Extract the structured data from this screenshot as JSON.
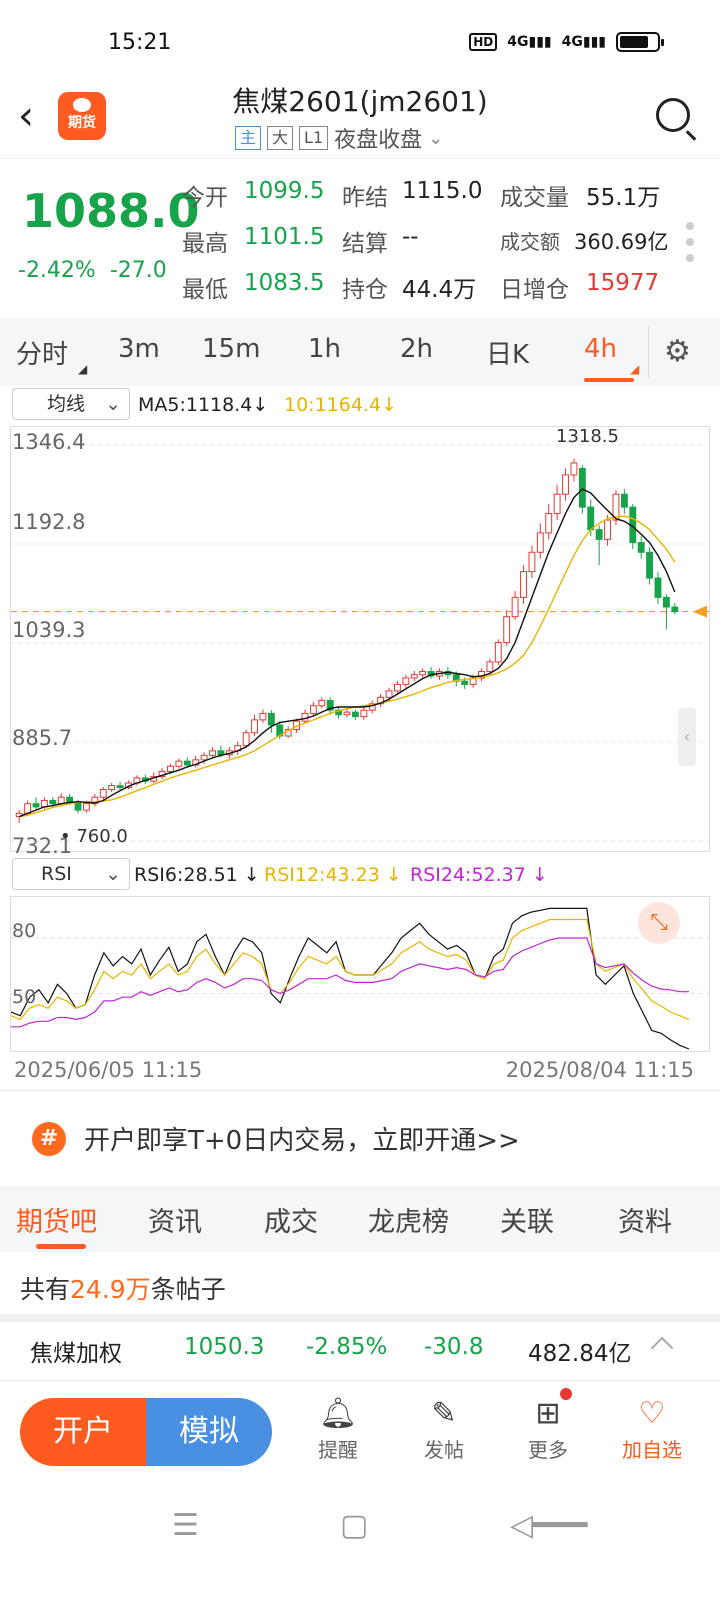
{
  "status_bar": {
    "time": "15:21",
    "hd_label": "HD",
    "signal1": "4G",
    "signal2": "4G"
  },
  "header": {
    "back_icon": "chevron-left-icon",
    "logo_text": "期货",
    "title": "焦煤2601(jm2601)",
    "tags": [
      "主",
      "大",
      "L1"
    ],
    "session": "夜盘收盘",
    "search_icon": "search-icon"
  },
  "quote": {
    "price": "1088.0",
    "change_pct": "-2.42%",
    "change": "-27.0",
    "fields": [
      {
        "label": "今开",
        "value": "1099.5",
        "color": "green"
      },
      {
        "label": "昨结",
        "value": "1115.0",
        "color": "dark"
      },
      {
        "label": "成交量",
        "value": "55.1万",
        "color": "dark"
      },
      {
        "label": "最高",
        "value": "1101.5",
        "color": "green"
      },
      {
        "label": "结算",
        "value": "--",
        "color": "dark"
      },
      {
        "label": "成交额",
        "value": "360.69亿",
        "color": "dark"
      },
      {
        "label": "最低",
        "value": "1083.5",
        "color": "green"
      },
      {
        "label": "持仓",
        "value": "44.4万",
        "color": "dark"
      },
      {
        "label": "日增仓",
        "value": "15977",
        "color": "red"
      }
    ]
  },
  "timeframes": {
    "items": [
      "分时",
      "3m",
      "15m",
      "1h",
      "2h",
      "日K",
      "4h"
    ],
    "active": "4h"
  },
  "ma_bar": {
    "selector": "均线",
    "ma5": "MA5:1118.4",
    "ma10": "10:1164.4",
    "ma5_arrow": "↓",
    "ma10_arrow": "↓"
  },
  "rsi_bar": {
    "selector": "RSI",
    "rsi6": "RSI6:28.51",
    "rsi12": "RSI12:43.23",
    "rsi24": "RSI24:52.37",
    "arrow": "↓"
  },
  "chart_data": [
    {
      "type": "candlestick",
      "y_ticks": [
        "1346.4",
        "1192.8",
        "1039.3",
        "885.7",
        "732.1"
      ],
      "ylim": [
        732.1,
        1346.4
      ],
      "high_label": "1318.5",
      "low_label": "760.0",
      "last_price": 1088.0,
      "colors": {
        "up": "#e53935",
        "down": "#16a34a",
        "ma5": "#111111",
        "ma10": "#e8b400"
      },
      "candles": [
        [
          770,
          775,
          760,
          780
        ],
        [
          775,
          790,
          772,
          795
        ],
        [
          790,
          785,
          780,
          800
        ],
        [
          785,
          795,
          782,
          800
        ],
        [
          795,
          790,
          785,
          800
        ],
        [
          790,
          800,
          786,
          806
        ],
        [
          800,
          792,
          788,
          805
        ],
        [
          792,
          780,
          775,
          796
        ],
        [
          780,
          790,
          776,
          795
        ],
        [
          790,
          800,
          786,
          805
        ],
        [
          800,
          812,
          796,
          816
        ],
        [
          812,
          818,
          808,
          822
        ],
        [
          818,
          815,
          810,
          824
        ],
        [
          815,
          822,
          812,
          826
        ],
        [
          822,
          830,
          818,
          834
        ],
        [
          830,
          825,
          820,
          835
        ],
        [
          825,
          832,
          822,
          838
        ],
        [
          832,
          840,
          828,
          845
        ],
        [
          840,
          848,
          836,
          852
        ],
        [
          848,
          856,
          844,
          860
        ],
        [
          856,
          850,
          846,
          862
        ],
        [
          850,
          858,
          846,
          864
        ],
        [
          858,
          865,
          852,
          870
        ],
        [
          865,
          872,
          860,
          878
        ],
        [
          872,
          866,
          862,
          880
        ],
        [
          866,
          872,
          860,
          878
        ],
        [
          872,
          880,
          866,
          886
        ],
        [
          880,
          900,
          876,
          905
        ],
        [
          900,
          920,
          895,
          928
        ],
        [
          920,
          930,
          915,
          936
        ],
        [
          930,
          912,
          900,
          935
        ],
        [
          912,
          895,
          890,
          918
        ],
        [
          895,
          905,
          892,
          910
        ],
        [
          905,
          918,
          900,
          922
        ],
        [
          918,
          930,
          914,
          936
        ],
        [
          930,
          942,
          926,
          948
        ],
        [
          942,
          950,
          938,
          955
        ],
        [
          950,
          935,
          928,
          955
        ],
        [
          935,
          928,
          922,
          940
        ],
        [
          928,
          932,
          924,
          938
        ],
        [
          932,
          925,
          920,
          936
        ],
        [
          925,
          935,
          920,
          940
        ],
        [
          935,
          945,
          930,
          950
        ],
        [
          945,
          955,
          940,
          960
        ],
        [
          955,
          965,
          950,
          970
        ],
        [
          965,
          975,
          960,
          980
        ],
        [
          975,
          985,
          970,
          990
        ],
        [
          985,
          990,
          980,
          996
        ],
        [
          990,
          995,
          986,
          1000
        ],
        [
          995,
          988,
          984,
          1002
        ],
        [
          988,
          995,
          982,
          1000
        ],
        [
          995,
          990,
          984,
          1002
        ],
        [
          990,
          980,
          972,
          995
        ],
        [
          980,
          975,
          968,
          986
        ],
        [
          975,
          985,
          970,
          990
        ],
        [
          985,
          995,
          980,
          1000
        ],
        [
          995,
          1010,
          990,
          1015
        ],
        [
          1010,
          1040,
          1005,
          1045
        ],
        [
          1040,
          1080,
          1035,
          1090
        ],
        [
          1080,
          1110,
          1075,
          1120
        ],
        [
          1110,
          1150,
          1100,
          1160
        ],
        [
          1150,
          1180,
          1140,
          1190
        ],
        [
          1180,
          1210,
          1170,
          1225
        ],
        [
          1210,
          1240,
          1200,
          1255
        ],
        [
          1240,
          1270,
          1230,
          1285
        ],
        [
          1270,
          1300,
          1260,
          1310
        ],
        [
          1300,
          1318.5,
          1290,
          1325
        ],
        [
          1310,
          1250,
          1240,
          1315
        ],
        [
          1250,
          1215,
          1205,
          1262
        ],
        [
          1215,
          1200,
          1160,
          1222
        ],
        [
          1200,
          1230,
          1190,
          1238
        ],
        [
          1230,
          1270,
          1222,
          1276
        ],
        [
          1270,
          1250,
          1240,
          1278
        ],
        [
          1250,
          1195,
          1185,
          1255
        ],
        [
          1195,
          1180,
          1170,
          1205
        ],
        [
          1180,
          1140,
          1130,
          1188
        ],
        [
          1140,
          1110,
          1100,
          1150
        ],
        [
          1110,
          1095,
          1060,
          1115
        ],
        [
          1095,
          1088,
          1083.5,
          1101.5
        ]
      ],
      "ma5": [
        770,
        775,
        780,
        785,
        787,
        790,
        792,
        793,
        792,
        791,
        795,
        803,
        810,
        817,
        822,
        826,
        830,
        834,
        838,
        842,
        847,
        851,
        856,
        861,
        865,
        868,
        872,
        878,
        888,
        900,
        910,
        916,
        918,
        920,
        922,
        926,
        932,
        938,
        940,
        940,
        940,
        940,
        942,
        946,
        952,
        960,
        968,
        976,
        984,
        990,
        992,
        994,
        992,
        990,
        987,
        988,
        992,
        1000,
        1015,
        1040,
        1075,
        1110,
        1145,
        1180,
        1210,
        1240,
        1265,
        1278,
        1272,
        1258,
        1245,
        1232,
        1228,
        1220,
        1208,
        1195,
        1175,
        1150,
        1118.4
      ],
      "ma10": [
        770,
        772,
        776,
        780,
        784,
        787,
        790,
        792,
        793,
        793,
        794,
        796,
        800,
        805,
        810,
        815,
        820,
        825,
        830,
        834,
        838,
        842,
        846,
        850,
        854,
        858,
        862,
        866,
        872,
        880,
        888,
        896,
        903,
        910,
        915,
        920,
        925,
        930,
        934,
        937,
        940,
        942,
        944,
        946,
        949,
        952,
        956,
        960,
        965,
        970,
        974,
        978,
        981,
        983,
        984,
        986,
        989,
        993,
        999,
        1008,
        1020,
        1040,
        1065,
        1092,
        1120,
        1148,
        1175,
        1198,
        1215,
        1225,
        1232,
        1235,
        1236,
        1232,
        1225,
        1215,
        1200,
        1185,
        1164.4
      ]
    },
    {
      "type": "line",
      "ylim": [
        20,
        100
      ],
      "y_ticks": [
        "80",
        "50"
      ],
      "x_labels": [
        "2025/06/05 11:15",
        "2025/08/04 11:15"
      ],
      "series": [
        {
          "name": "RSI6",
          "color": "#111111",
          "values": [
            40,
            38,
            48,
            52,
            45,
            55,
            50,
            42,
            44,
            60,
            72,
            65,
            70,
            66,
            74,
            60,
            68,
            75,
            62,
            66,
            78,
            82,
            70,
            60,
            72,
            80,
            78,
            72,
            50,
            45,
            58,
            70,
            80,
            76,
            72,
            78,
            62,
            60,
            60,
            60,
            66,
            72,
            80,
            84,
            88,
            82,
            78,
            74,
            76,
            72,
            60,
            58,
            70,
            74,
            88,
            92,
            94,
            95,
            96,
            96,
            96,
            96,
            96,
            60,
            55,
            60,
            65,
            50,
            40,
            30,
            28.51,
            25,
            22,
            20
          ]
        },
        {
          "name": "RSI12",
          "color": "#e8b400",
          "values": [
            38,
            36,
            42,
            44,
            42,
            48,
            46,
            42,
            44,
            52,
            62,
            58,
            62,
            60,
            66,
            58,
            62,
            66,
            60,
            62,
            70,
            74,
            66,
            60,
            66,
            72,
            70,
            66,
            52,
            50,
            56,
            64,
            70,
            68,
            66,
            70,
            62,
            60,
            60,
            60,
            63,
            66,
            72,
            75,
            78,
            74,
            72,
            70,
            71,
            68,
            60,
            58,
            66,
            68,
            80,
            84,
            86,
            88,
            90,
            90,
            90,
            90,
            90,
            66,
            62,
            64,
            66,
            58,
            52,
            46,
            43.23,
            40,
            38,
            36
          ]
        },
        {
          "name": "RSI24",
          "color": "#c026d3",
          "values": [
            32,
            32,
            34,
            35,
            35,
            37,
            37,
            36,
            37,
            40,
            46,
            46,
            48,
            48,
            51,
            49,
            51,
            53,
            51,
            52,
            56,
            58,
            56,
            53,
            55,
            58,
            58,
            57,
            52,
            50,
            52,
            55,
            58,
            58,
            58,
            60,
            57,
            56,
            56,
            56,
            57,
            58,
            62,
            64,
            66,
            65,
            64,
            63,
            64,
            63,
            60,
            59,
            62,
            63,
            70,
            73,
            75,
            77,
            79,
            80,
            80,
            80,
            80,
            66,
            64,
            65,
            66,
            61,
            57,
            54,
            52.37,
            52,
            51,
            51
          ]
        }
      ]
    }
  ],
  "rsi_axis": {
    "label80": "80",
    "label50": "50"
  },
  "dates": {
    "start": "2025/06/05 11:15",
    "end": "2025/08/04 11:15"
  },
  "promo": {
    "badge": "#",
    "text": "开户即享T+0日内交易，立即开通>>"
  },
  "section_tabs": {
    "items": [
      "期货吧",
      "资讯",
      "成交",
      "龙虎榜",
      "关联",
      "资料"
    ],
    "active": "期货吧"
  },
  "posts": {
    "prefix": "共有",
    "count": "24.9万",
    "suffix": "条帖子"
  },
  "related": {
    "name": "焦煤加权",
    "price": "1050.3",
    "change_pct": "-2.85%",
    "change": "-30.8",
    "amount": "482.84亿"
  },
  "actions": {
    "open_account": "开户",
    "simulate": "模拟",
    "items": [
      {
        "label": "提醒",
        "icon": "bell-icon"
      },
      {
        "label": "发帖",
        "icon": "compose-icon"
      },
      {
        "label": "更多",
        "icon": "grid-icon"
      },
      {
        "label": "加自选",
        "icon": "heart-icon"
      }
    ]
  }
}
